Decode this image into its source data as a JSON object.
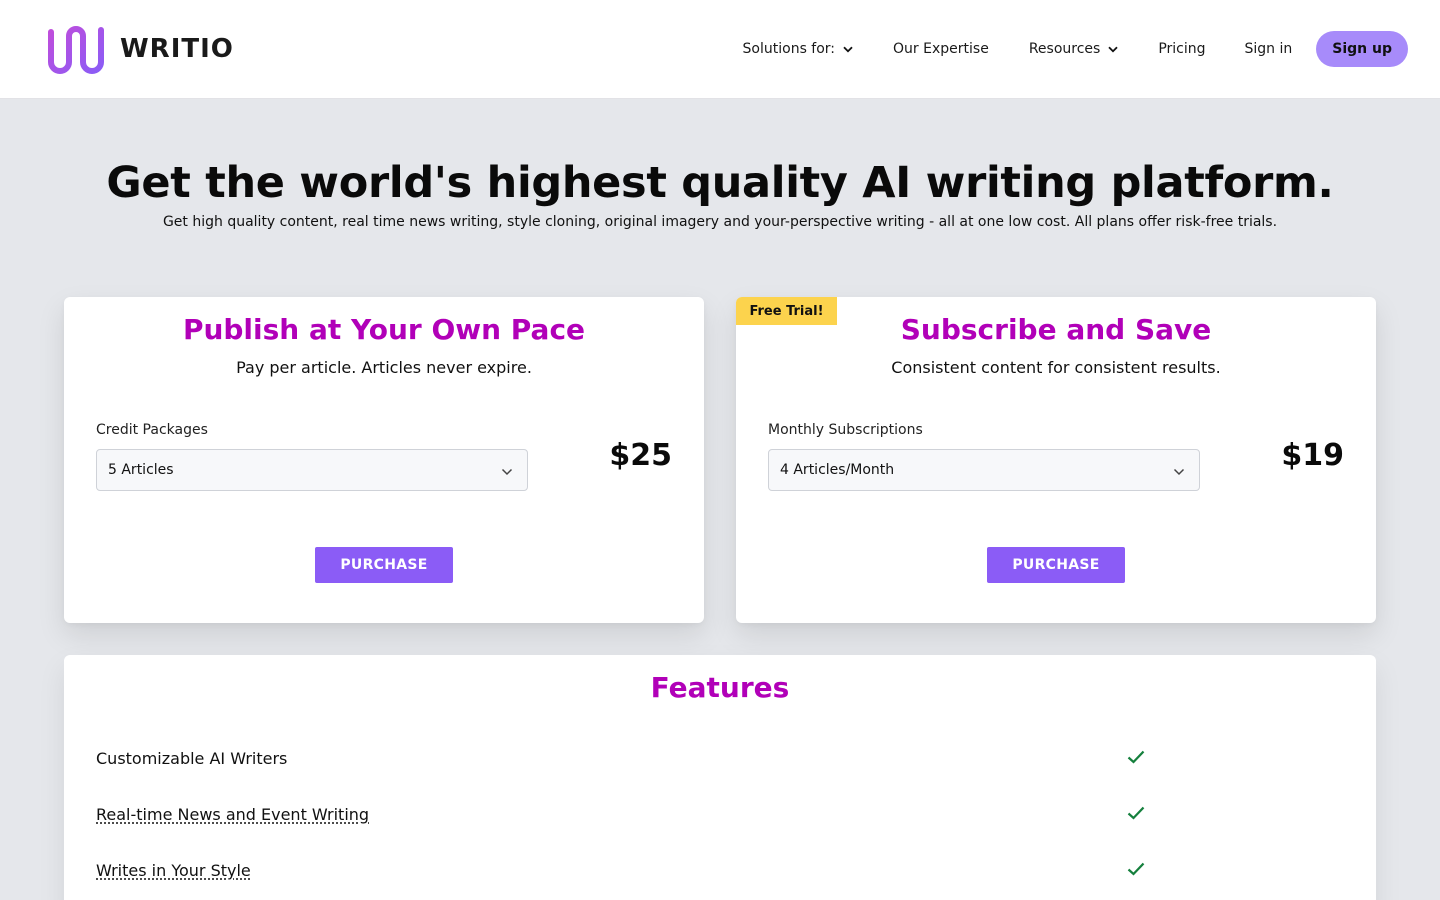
{
  "brand": {
    "name": "WRITIO"
  },
  "nav": {
    "solutions": "Solutions for:",
    "expertise": "Our Expertise",
    "resources": "Resources",
    "pricing": "Pricing",
    "signin": "Sign in",
    "signup": "Sign up"
  },
  "hero": {
    "title": "Get the world's highest quality AI writing platform.",
    "subtitle": "Get high quality content, real time news writing, style cloning, original imagery and your-perspective writing - all at one low cost. All plans offer risk-free trials."
  },
  "plans": [
    {
      "title": "Publish at Your Own Pace",
      "subtitle": "Pay per article. Articles never expire.",
      "field_label": "Credit Packages",
      "selected": "5 Articles",
      "price": "$25",
      "button": "PURCHASE"
    },
    {
      "badge": "Free Trial!",
      "title": "Subscribe and Save",
      "subtitle": "Consistent content for consistent results.",
      "field_label": "Monthly Subscriptions",
      "selected": "4 Articles/Month",
      "price": "$19",
      "button": "PURCHASE"
    }
  ],
  "features": {
    "title": "Features",
    "items": [
      {
        "label": "Customizable AI Writers",
        "included": true
      },
      {
        "label": "Real-time News and Event Writing",
        "included": true
      },
      {
        "label": "Writes in Your Style",
        "included": true
      }
    ]
  },
  "colors": {
    "accent": "#8b5cf6",
    "signup_bg": "#a78bfa",
    "heading": "#b100b8",
    "badge": "#fcd34d",
    "check": "#15803d"
  }
}
